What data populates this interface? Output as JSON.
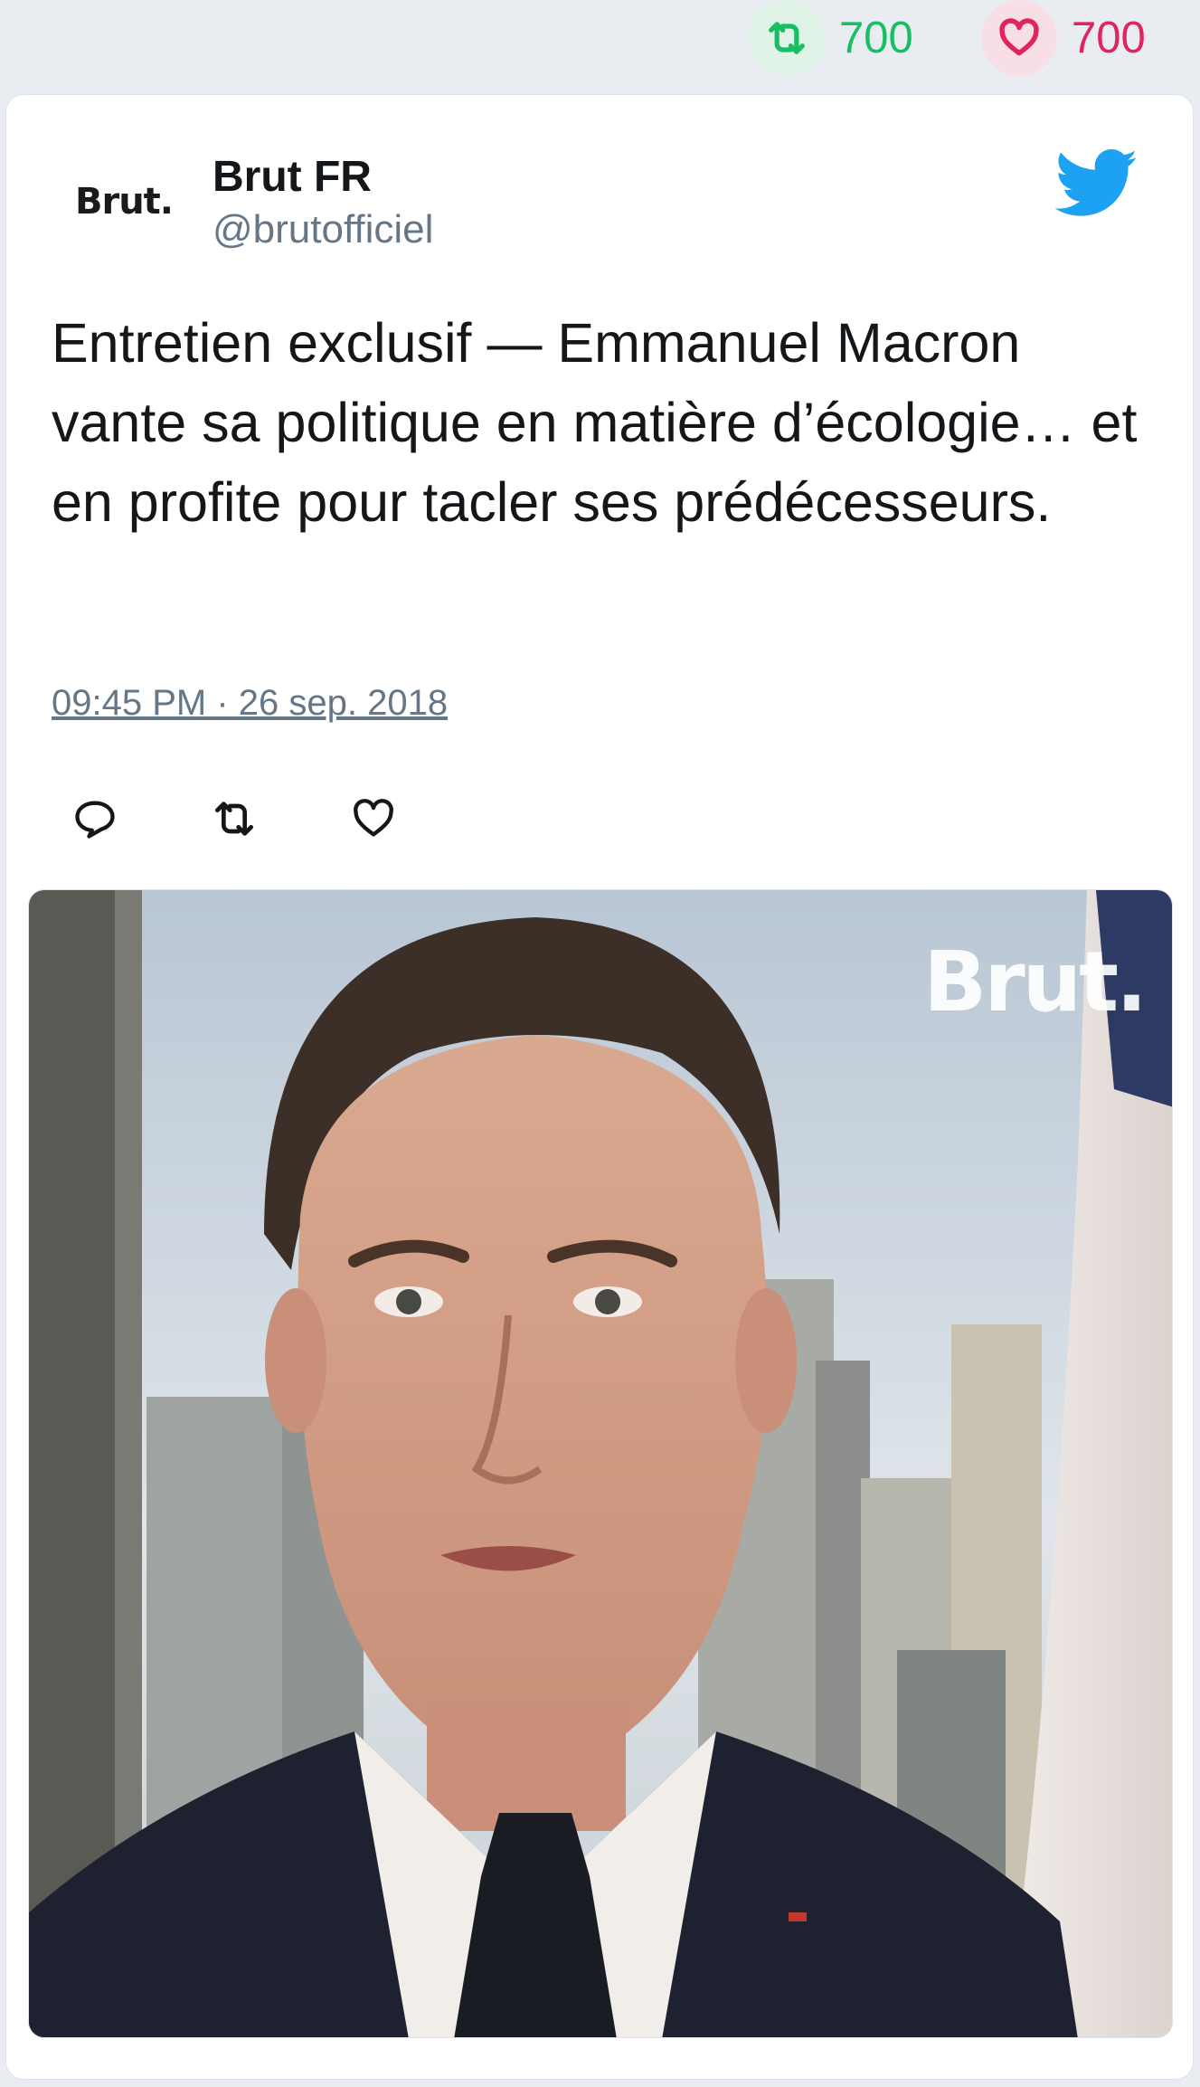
{
  "stats": {
    "retweets": "700",
    "likes": "700",
    "retweet_color": "#17bf63",
    "like_color": "#e0245e"
  },
  "tweet": {
    "avatar_text": "Brut.",
    "display_name": "Brut FR",
    "handle": "@brutofficiel",
    "text": "Entretien exclusif — Emmanuel Macron vante sa politique en matière d’écologie… et en profite pour tacler ses prédécesseurs.",
    "timestamp": "09:45 PM · 26 sep. 2018",
    "actions": [
      "reply-icon",
      "retweet-icon",
      "like-icon"
    ],
    "brand_icon": "twitter-bird-icon",
    "brand_color": "#1da1f2"
  },
  "media": {
    "watermark": "Brut."
  }
}
